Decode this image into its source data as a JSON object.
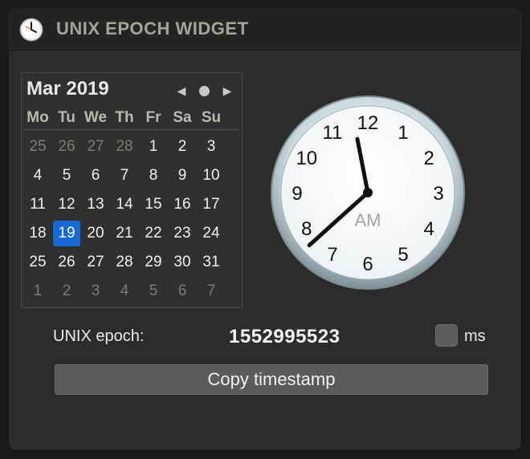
{
  "window": {
    "title": "UNIX EPOCH WIDGET",
    "icon": "clock-icon"
  },
  "calendar": {
    "month_label": "Mar 2019",
    "nav": {
      "prev_icon": "chevron-left-icon",
      "today_icon": "dot-icon",
      "next_icon": "chevron-right-icon"
    },
    "weekdays": [
      "Mo",
      "Tu",
      "We",
      "Th",
      "Fr",
      "Sa",
      "Su"
    ],
    "weeks": [
      [
        {
          "d": "25",
          "m": true
        },
        {
          "d": "26",
          "m": true
        },
        {
          "d": "27",
          "m": true
        },
        {
          "d": "28",
          "m": true
        },
        {
          "d": "1"
        },
        {
          "d": "2"
        },
        {
          "d": "3"
        }
      ],
      [
        {
          "d": "4"
        },
        {
          "d": "5"
        },
        {
          "d": "6"
        },
        {
          "d": "7"
        },
        {
          "d": "8"
        },
        {
          "d": "9"
        },
        {
          "d": "10"
        }
      ],
      [
        {
          "d": "11"
        },
        {
          "d": "12"
        },
        {
          "d": "13"
        },
        {
          "d": "14"
        },
        {
          "d": "15"
        },
        {
          "d": "16"
        },
        {
          "d": "17"
        }
      ],
      [
        {
          "d": "18"
        },
        {
          "d": "19",
          "s": true
        },
        {
          "d": "20"
        },
        {
          "d": "21"
        },
        {
          "d": "22"
        },
        {
          "d": "23"
        },
        {
          "d": "24"
        }
      ],
      [
        {
          "d": "25"
        },
        {
          "d": "26"
        },
        {
          "d": "27"
        },
        {
          "d": "28"
        },
        {
          "d": "29"
        },
        {
          "d": "30"
        },
        {
          "d": "31"
        }
      ],
      [
        {
          "d": "1",
          "m": true
        },
        {
          "d": "2",
          "m": true
        },
        {
          "d": "3",
          "m": true
        },
        {
          "d": "4",
          "m": true
        },
        {
          "d": "5",
          "m": true
        },
        {
          "d": "6",
          "m": true
        },
        {
          "d": "7",
          "m": true
        }
      ]
    ],
    "selected_color": "#1769d6"
  },
  "clock": {
    "numbers": [
      "12",
      "1",
      "2",
      "3",
      "4",
      "5",
      "6",
      "7",
      "8",
      "9",
      "10",
      "11"
    ],
    "period": "AM",
    "hour": 11,
    "minute": 38
  },
  "epoch": {
    "label": "UNIX epoch:",
    "value": "1552995523",
    "ms_label": "ms",
    "ms_checked": false
  },
  "copy_button": {
    "label": "Copy timestamp"
  }
}
